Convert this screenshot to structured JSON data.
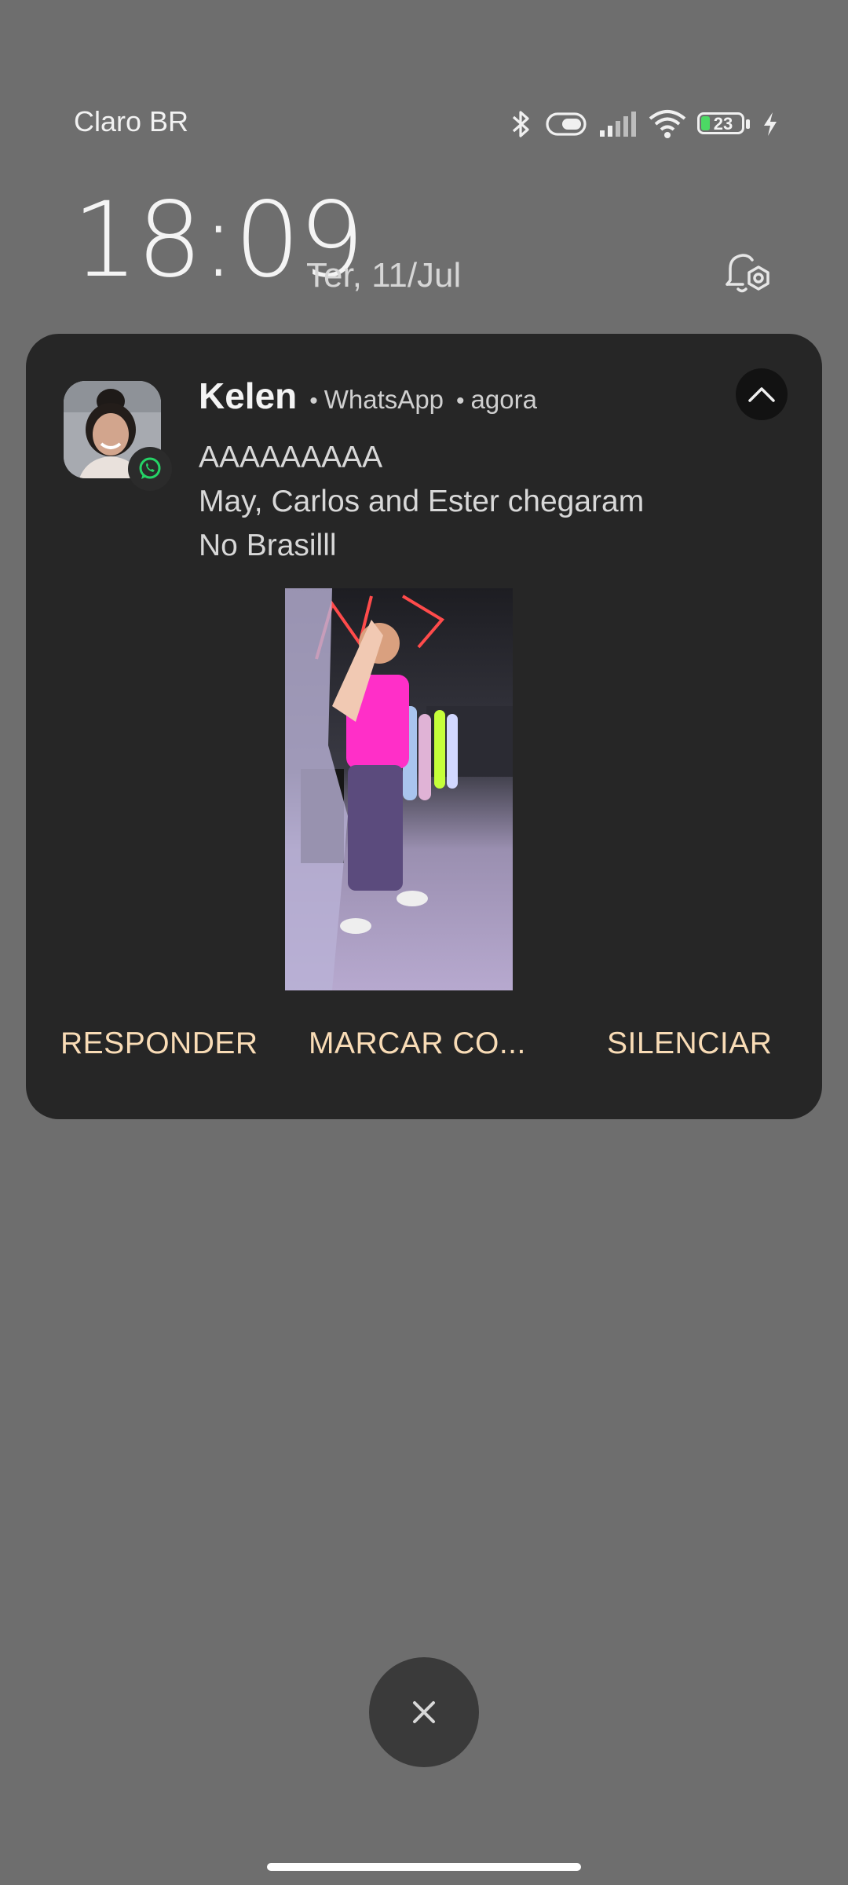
{
  "status_bar": {
    "carrier": "Claro BR",
    "battery_level": "23",
    "icons": [
      "bluetooth-icon",
      "vibrate-icon",
      "signal-icon",
      "wifi-icon",
      "battery-icon",
      "charging-icon"
    ]
  },
  "lockscreen": {
    "time": "18:09",
    "date": "Ter, 11/Jul"
  },
  "notification": {
    "sender": "Kelen",
    "app": "WhatsApp",
    "time_ago": "agora",
    "messages": [
      "AAAAAAAAA",
      "May, Carlos and Ester chegaram",
      "No Brasilll"
    ],
    "actions": [
      "RESPONDER",
      "MARCAR CO...",
      "SILENCIAR"
    ],
    "colors": {
      "card": "#262626",
      "action_text": "#f9dcb6",
      "whatsapp_green": "#25d366"
    }
  }
}
